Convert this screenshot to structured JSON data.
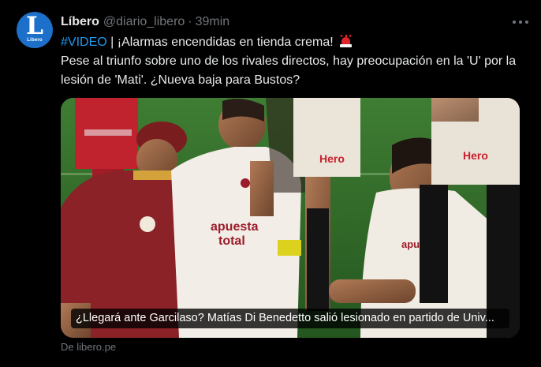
{
  "account": {
    "avatar_letter": "L",
    "avatar_word": "Libero",
    "display_name": "Líbero",
    "handle": "@diario_libero",
    "separator": "·",
    "time": "39min"
  },
  "tweet": {
    "hashtag": "#VIDEO",
    "line1_rest": " | ¡Alarmas encendidas en tienda crema! ",
    "emoji": "rotating-light-icon",
    "body": "Pese al triunfo sobre uno de los rivales directos, hay preocupación en la 'U' por la lesión de 'Mati'. ¿Nueva baja para Bustos?"
  },
  "card": {
    "caption": "¿Llegará ante Garcilaso? Matías Di Benedetto salió lesionado en partido de Univ...",
    "source": "De libero.pe",
    "shirt_sponsor_left": "apuesta total",
    "shirt_sponsor_right": "Hero"
  },
  "colors": {
    "background": "#000000",
    "text": "#e7e9ea",
    "muted": "#71767b",
    "link": "#1d9bf0",
    "avatar": "#1d70c9"
  }
}
